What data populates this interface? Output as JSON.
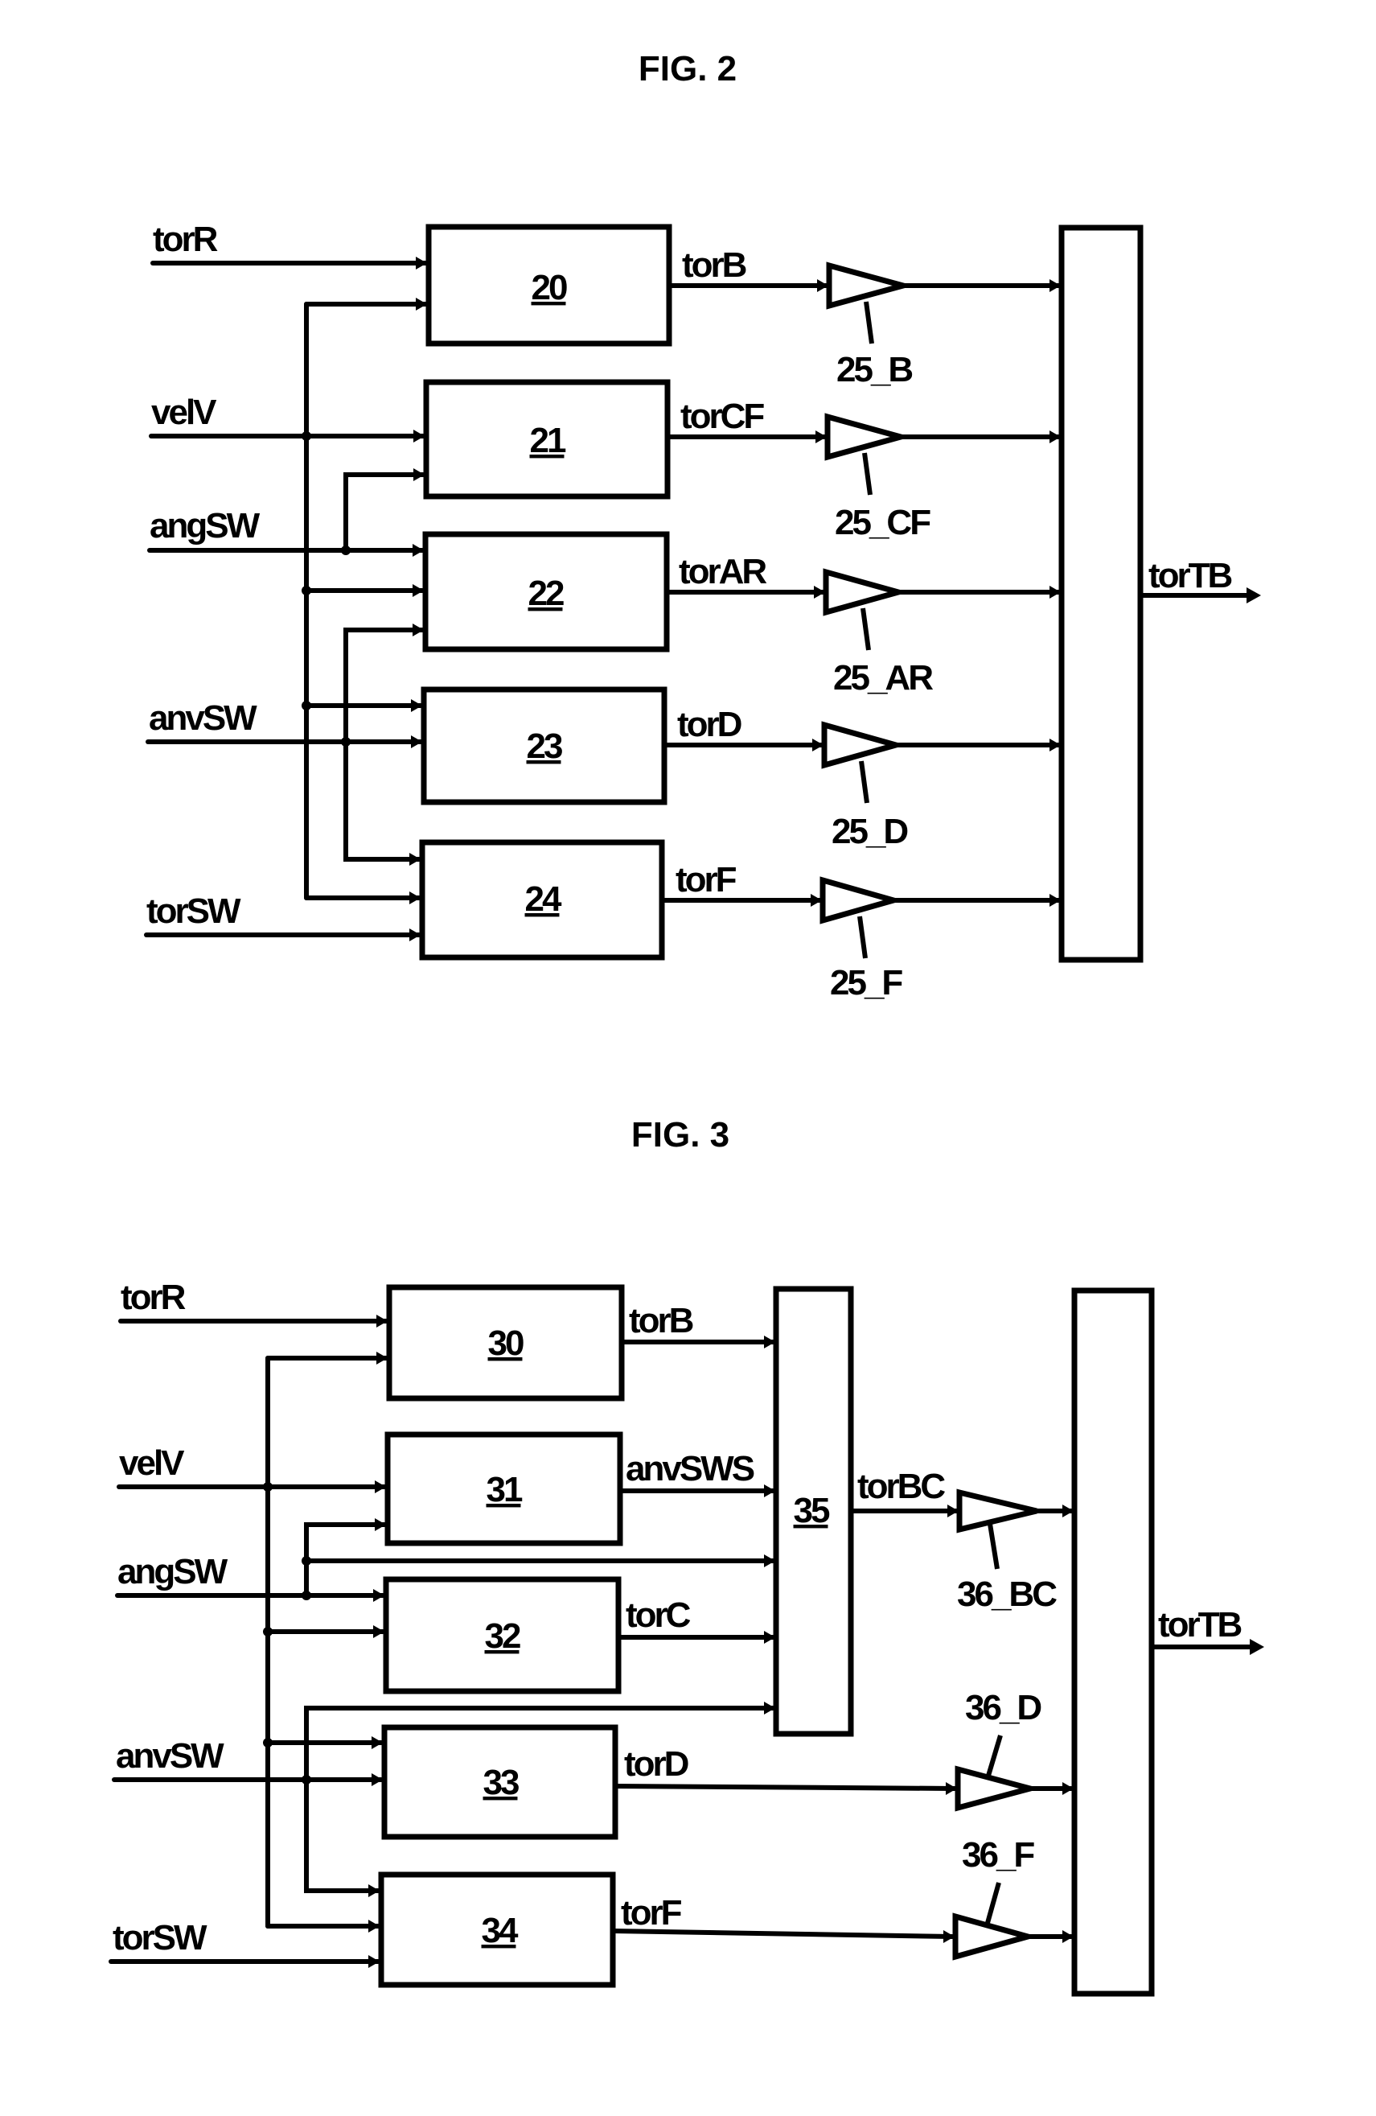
{
  "page": {
    "background": "#ffffff",
    "ink": "#000000"
  },
  "fig2": {
    "title": "FIG. 2",
    "inputs": [
      "torR",
      "velV",
      "angSW",
      "anvSW",
      "torSW"
    ],
    "blocks": [
      "20",
      "21",
      "22",
      "23",
      "24"
    ],
    "outputs": [
      "torB",
      "torCF",
      "torAR",
      "torD",
      "torF"
    ],
    "gains": [
      "25_B",
      "25_CF",
      "25_AR",
      "25_D",
      "25_F"
    ],
    "result": "torTB"
  },
  "fig3": {
    "title": "FIG. 3",
    "inputs": [
      "torR",
      "velV",
      "angSW",
      "anvSW",
      "torSW"
    ],
    "blocks": [
      "30",
      "31",
      "32",
      "33",
      "34"
    ],
    "combiner": "35",
    "outputs": [
      "torB",
      "anvSWS",
      "torC",
      "torD",
      "torF"
    ],
    "combined_output": "torBC",
    "gains": [
      "36_BC",
      "36_D",
      "36_F"
    ],
    "result": "torTB"
  }
}
